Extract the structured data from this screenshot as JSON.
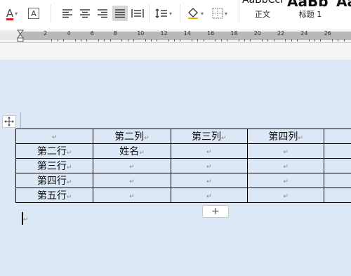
{
  "ribbon": {
    "font_color_letter": "A",
    "font_color_accent": "#d9211e",
    "clear_format_letter": "A",
    "styles": [
      {
        "sample": "AaBbCcI",
        "label": "正文"
      },
      {
        "sample": "AaBb",
        "label": "标题 1"
      },
      {
        "sample": "AaB",
        "label": ""
      }
    ]
  },
  "ruler": {
    "numbers": [
      "2",
      "4",
      "6",
      "8",
      "10",
      "12",
      "14",
      "16",
      "18",
      "20",
      "22",
      "24",
      "26"
    ]
  },
  "table": {
    "header": [
      "",
      "第二列",
      "第三列",
      "第四列",
      ""
    ],
    "rows": [
      [
        "第二行",
        "姓名",
        "",
        "",
        ""
      ],
      [
        "第三行",
        "",
        "",
        "",
        ""
      ],
      [
        "第四行",
        "",
        "",
        "",
        ""
      ],
      [
        "第五行",
        "",
        "",
        "",
        ""
      ]
    ]
  },
  "controls": {
    "add_row_label": "+",
    "paragraph_mark": "↵"
  }
}
